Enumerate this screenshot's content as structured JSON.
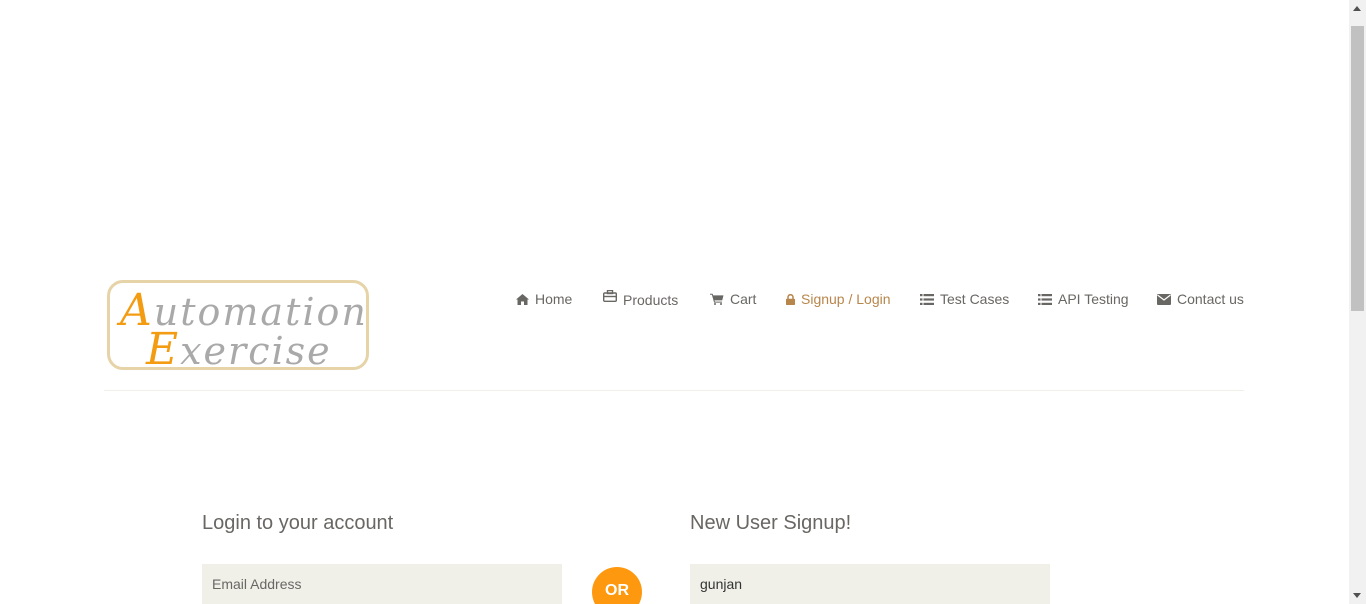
{
  "logo": {
    "line1_first": "A",
    "line1_rest": "utomation",
    "line2_first": "E",
    "line2_rest": "xercise"
  },
  "nav": {
    "items": [
      {
        "label": "Home",
        "icon": "home-icon"
      },
      {
        "label": "Products",
        "icon": "products-icon"
      },
      {
        "label": "Cart",
        "icon": "cart-icon"
      },
      {
        "label": "Signup / Login",
        "icon": "lock-icon",
        "active": true
      },
      {
        "label": "Test Cases",
        "icon": "list-icon"
      },
      {
        "label": "API Testing",
        "icon": "list-icon"
      },
      {
        "label": "Contact us",
        "icon": "envelope-icon"
      }
    ]
  },
  "login": {
    "title": "Login to your account",
    "email_placeholder": "Email Address"
  },
  "or_label": "OR",
  "signup": {
    "title": "New User Signup!",
    "name_value": "gunjan"
  },
  "colors": {
    "accent": "#fe980f",
    "nav_active": "#b8864b",
    "text": "#696763",
    "input_bg": "#f0f0e9"
  }
}
